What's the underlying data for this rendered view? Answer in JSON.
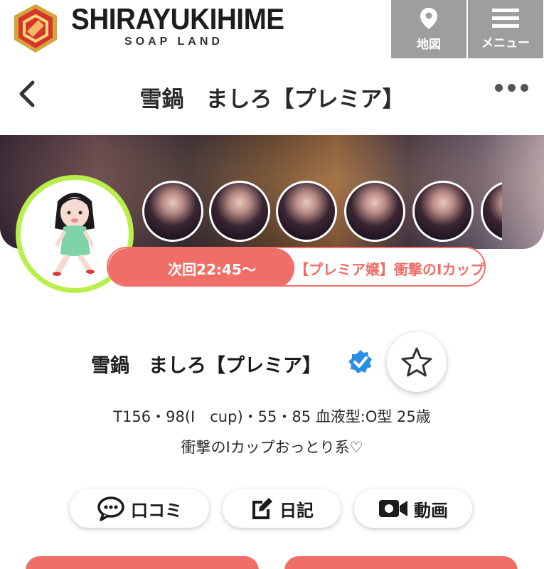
{
  "header": {
    "brand_name": "SHIRAYUKIHIME",
    "brand_sub": "SOAP LAND",
    "map_label": "地図",
    "menu_label": "メニュー"
  },
  "titlebar": {
    "title": "雪鍋　ましろ【プレミア】"
  },
  "schedule": {
    "next_label": "次回22:45〜",
    "ticker_text": "【プレミア嬢】衝撃のIカップおっとり系♡"
  },
  "profile": {
    "name": "雪鍋　ましろ【プレミア】",
    "stats": "T156・98(I　cup)・55・85  血液型:O型  25歳",
    "catchphrase": "衝撃のIカップおっとり系♡"
  },
  "actions": {
    "kuchikomi": "口コミ",
    "diary": "日記",
    "video": "動画"
  },
  "colors": {
    "accent": "#ef6f68",
    "avatar_ring": "#b9ef4a",
    "header_button": "#9e9e9e",
    "verified": "#2b8ee6"
  }
}
